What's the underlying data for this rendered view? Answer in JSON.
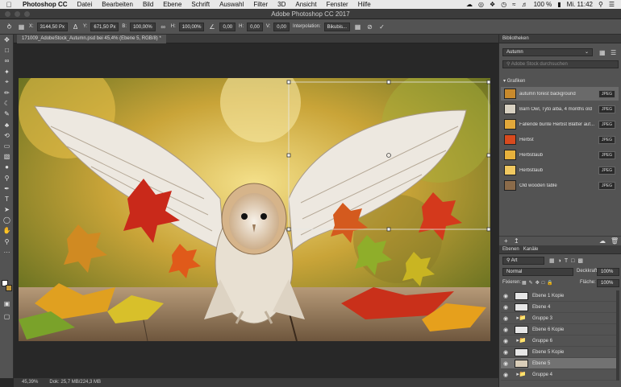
{
  "menubar": {
    "app": "Photoshop CC",
    "items": [
      "Datei",
      "Bearbeiten",
      "Bild",
      "Ebene",
      "Schrift",
      "Auswahl",
      "Filter",
      "3D",
      "Ansicht",
      "Fenster",
      "Hilfe"
    ],
    "battery": "100 %",
    "clock": "Mi. 11:42"
  },
  "window": {
    "title": "Adobe Photoshop CC 2017"
  },
  "options": {
    "x_label": "X:",
    "x": "3144,50 Px",
    "y_label": "Y:",
    "y": "671,50 Px",
    "w_label": "B:",
    "w": "100,00%",
    "h_label": "H:",
    "h": "100,00%",
    "angle": "0,00",
    "hskew_label": "H:",
    "hskew": "0,00",
    "vskew_label": "V:",
    "vskew": "0,00",
    "interp_label": "Interpolation:",
    "interp": "Bikubis..."
  },
  "document": {
    "tab": "171009_AdobeStock_Autumn.psd bei 45,4% (Ebene 5, RGB/8) *",
    "zoom": "45,39%",
    "doc_size": "Dok: 25,7 MB/224,3 MB"
  },
  "libraries": {
    "header": "Bibliotheken",
    "library": "Autumn",
    "search_placeholder": "Adobe Stock durchsuchen",
    "section": "Grafiken",
    "items": [
      {
        "name": "autumn forest background",
        "badge": "JPEG",
        "color": "#c98a2c"
      },
      {
        "name": "Barn Owl, Tyto alba, 4 months old",
        "badge": "JPEG",
        "color": "#d8d1c2"
      },
      {
        "name": "Fallende bunte Herbst Blätter auf...",
        "badge": "JPEG",
        "color": "#e2a83a"
      },
      {
        "name": "Herbst",
        "badge": "JPEG",
        "color": "#d84a1e"
      },
      {
        "name": "Herbstlaub",
        "badge": "JPEG",
        "color": "#e7b13c"
      },
      {
        "name": "Herbstlaub",
        "badge": "JPEG",
        "color": "#f0c860"
      },
      {
        "name": "Old wooden table",
        "badge": "JPEG",
        "color": "#8b6b4a"
      }
    ]
  },
  "layers_panel": {
    "tab_layers": "Ebenen",
    "tab_channels": "Kanäle",
    "filter_kind": "Art",
    "blend_mode": "Normal",
    "opacity_label": "Deckkraft:",
    "opacity": "100%",
    "lock_label": "Fixieren:",
    "fill_label": "Fläche:",
    "fill": "100%",
    "layers": [
      {
        "name": "Ebene 1 Kopie",
        "type": "layer"
      },
      {
        "name": "Ebene 4",
        "type": "layer"
      },
      {
        "name": "Gruppe 3",
        "type": "group"
      },
      {
        "name": "Ebene 6 Kopie",
        "type": "layer"
      },
      {
        "name": "Gruppe 6",
        "type": "group"
      },
      {
        "name": "Ebene 5 Kopie",
        "type": "layer"
      },
      {
        "name": "Ebene 5",
        "type": "layer",
        "selected": true
      },
      {
        "name": "Gruppe 4",
        "type": "group"
      }
    ]
  }
}
